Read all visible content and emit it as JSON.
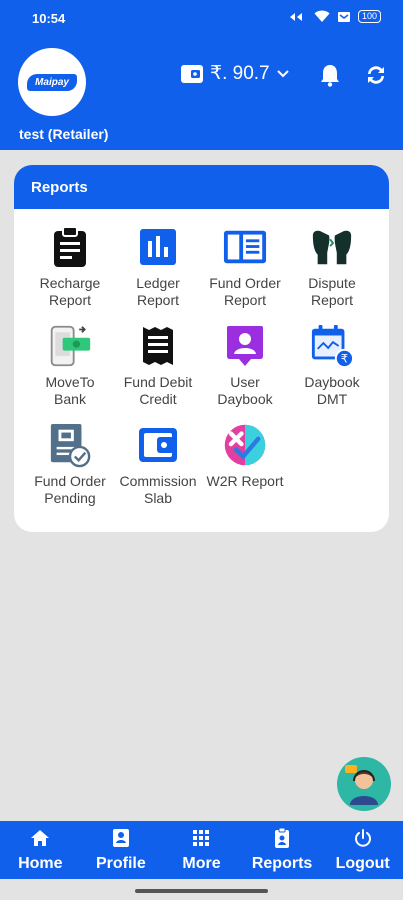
{
  "status_bar": {
    "time": "10:54",
    "battery": "100"
  },
  "header": {
    "logo_text": "Maipay",
    "user": "test (Retailer)",
    "wallet_balance": "₹. 90.7",
    "icons": [
      "wallet-icon",
      "chevron-down-icon",
      "bell-icon",
      "refresh-icon"
    ]
  },
  "reports": {
    "title": "Reports",
    "items": [
      {
        "line1": "Recharge",
        "line2": "Report",
        "icon": "clipboard-icon"
      },
      {
        "line1": "Ledger",
        "line2": "Report",
        "icon": "bar-chart-icon"
      },
      {
        "line1": "Fund Order",
        "line2": "Report",
        "icon": "list-icon"
      },
      {
        "line1": "Dispute",
        "line2": "Report",
        "icon": "dispute-icon"
      },
      {
        "line1": "MoveTo",
        "line2": "Bank",
        "icon": "phone-money-icon"
      },
      {
        "line1": "Fund Debit",
        "line2": "Credit",
        "icon": "receipt-icon"
      },
      {
        "line1": "User",
        "line2": "Daybook",
        "icon": "user-badge-icon"
      },
      {
        "line1": "Daybook",
        "line2": "DMT",
        "icon": "calendar-rupee-icon"
      },
      {
        "line1": "Fund Order",
        "line2": "Pending",
        "icon": "document-clock-icon"
      },
      {
        "line1": "Commission",
        "line2": "Slab",
        "icon": "wallet-icon"
      },
      {
        "line1": "W2R Report",
        "line2": "",
        "icon": "check-cross-icon"
      }
    ]
  },
  "support": {
    "icon": "support-agent-icon"
  },
  "nav": [
    {
      "label": "Home",
      "icon": "home-icon"
    },
    {
      "label": "Profile",
      "icon": "profile-icon"
    },
    {
      "label": "More",
      "icon": "grid-icon"
    },
    {
      "label": "Reports",
      "icon": "report-badge-icon"
    },
    {
      "label": "Logout",
      "icon": "power-icon"
    }
  ],
  "colors": {
    "primary": "#1060ec",
    "background": "#e3e3e3",
    "card": "#ffffff"
  }
}
